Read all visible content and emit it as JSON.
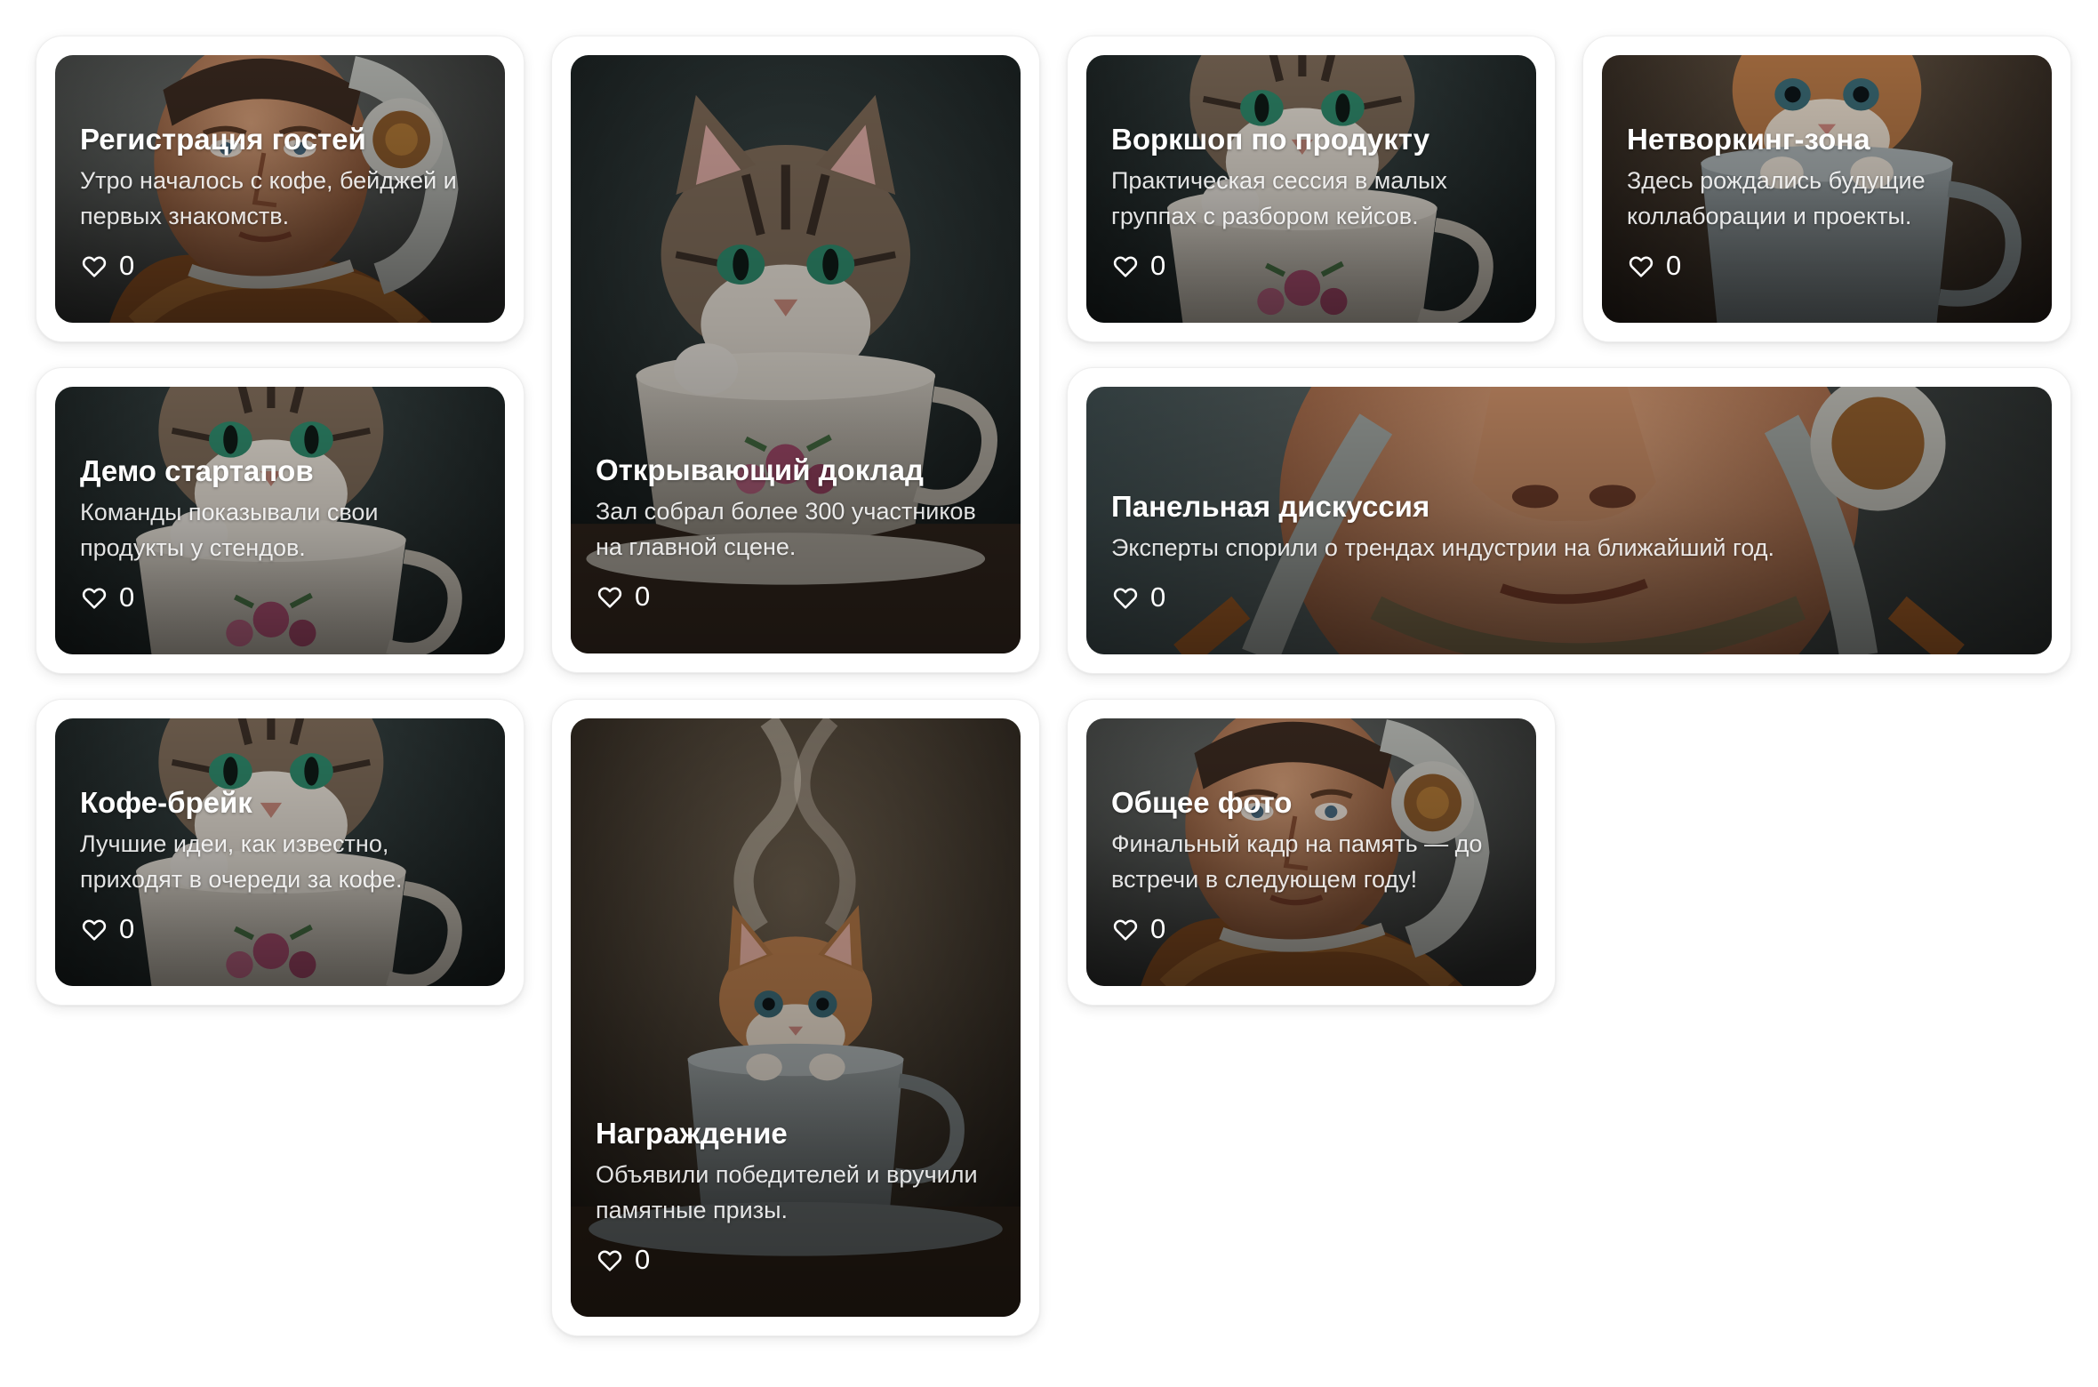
{
  "gallery": {
    "cards": [
      {
        "id": "registration",
        "title": "Регистрация гостей",
        "description": "Утро началось с кофе, бейджей и первых знакомств.",
        "likes": "0",
        "image": "astronaut-portrait"
      },
      {
        "id": "keynote",
        "title": "Открывающий доклад",
        "description": "Зал собрал более 300 участников на главной сцене.",
        "likes": "0",
        "image": "kitten-in-teacup"
      },
      {
        "id": "workshop",
        "title": "Воркшоп по продукту",
        "description": "Практическая сессия в малых группах с разбором кейсов.",
        "likes": "0",
        "image": "kitten-in-teacup"
      },
      {
        "id": "networking",
        "title": "Нетворкинг-зона",
        "description": "Здесь рождались будущие коллаборации и проекты.",
        "likes": "0",
        "image": "kitten-in-cup"
      },
      {
        "id": "demo",
        "title": "Демо стартапов",
        "description": "Команды показывали свои продукты у стендов.",
        "likes": "0",
        "image": "kitten-in-teacup"
      },
      {
        "id": "panel",
        "title": "Панельная дискуссия",
        "description": "Эксперты спорили о трендах индустрии на ближайший год.",
        "likes": "0",
        "image": "astronaut-closeup"
      },
      {
        "id": "coffee",
        "title": "Кофе-брейк",
        "description": "Лучшие идеи, как известно, приходят в очереди за кофе.",
        "likes": "0",
        "image": "kitten-in-teacup"
      },
      {
        "id": "awards",
        "title": "Награждение",
        "description": "Объявили победителей и вручили памятные призы.",
        "likes": "0",
        "image": "kitten-in-steaming-cup"
      },
      {
        "id": "group",
        "title": "Общее фото",
        "description": "Финальный кадр на память — до встречи в следующем году!",
        "likes": "0",
        "image": "astronaut-portrait"
      }
    ]
  },
  "icons": {
    "like": "heart-outline-icon"
  },
  "colors": {
    "card_background": "#ffffff",
    "text": "#ffffff",
    "photo_dark": "#1f2426",
    "astronaut_warm": "#8a5a36"
  }
}
